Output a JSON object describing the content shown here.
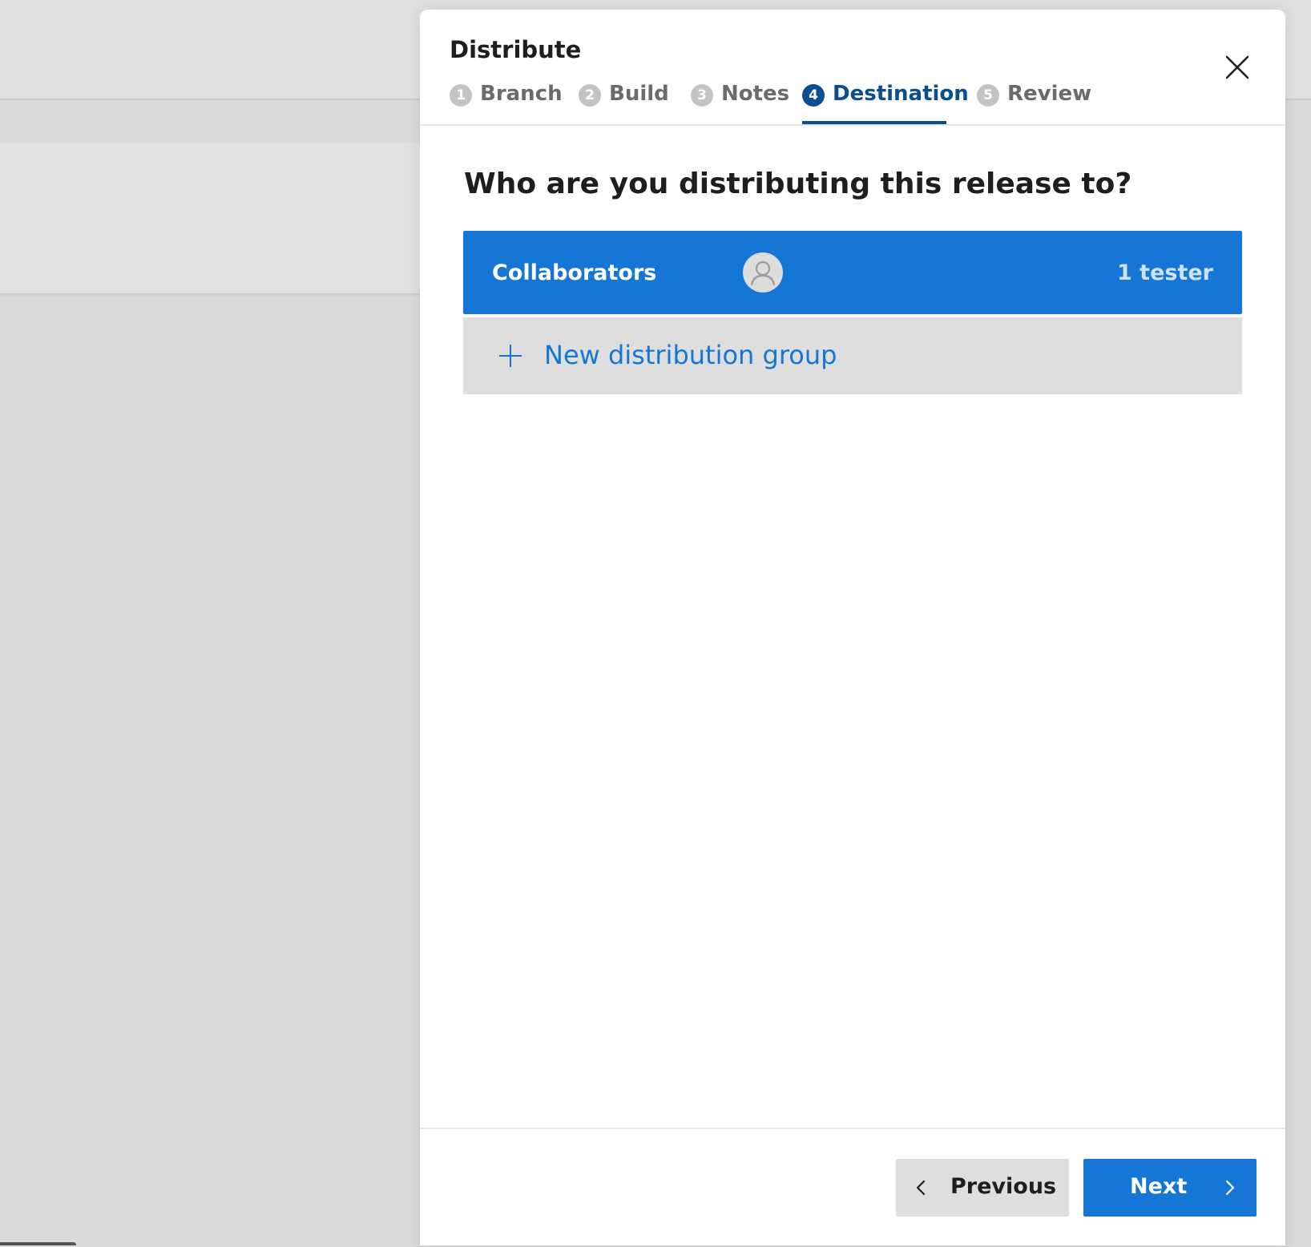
{
  "modal": {
    "title": "Distribute",
    "close_icon": "close-icon"
  },
  "steps": [
    {
      "number": "1",
      "label": "Branch",
      "state": "inactive"
    },
    {
      "number": "2",
      "label": "Build",
      "state": "inactive"
    },
    {
      "number": "3",
      "label": "Notes",
      "state": "inactive"
    },
    {
      "number": "4",
      "label": "Destination",
      "state": "active"
    },
    {
      "number": "5",
      "label": "Review",
      "state": "inactive"
    }
  ],
  "destination": {
    "question": "Who are you distributing this release to?",
    "groups": [
      {
        "name": "Collaborators",
        "avatar_icon": "person-icon",
        "count": "1 tester",
        "selected": true
      }
    ],
    "new_group": {
      "icon": "plus-icon",
      "label": "New distribution group"
    }
  },
  "footer": {
    "previous_label": "Previous",
    "previous_icon": "chevron-left-icon",
    "next_label": "Next",
    "next_icon": "chevron-right-icon"
  },
  "colors": {
    "accent": "#1676d5",
    "active_step": "#0a4d91",
    "inactive_step": "#6b6b6b",
    "backdrop": "#dadada"
  }
}
